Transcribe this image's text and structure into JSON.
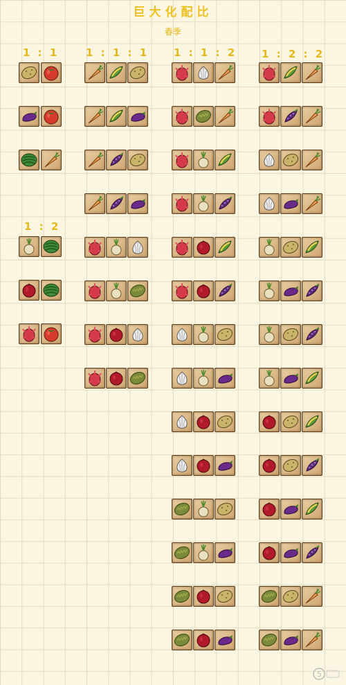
{
  "header": {
    "title": "巨大化配比",
    "season": "春季"
  },
  "ratios": {
    "r11": "1 : 1",
    "r12": "1 : 2",
    "r111": "1 : 1 : 1",
    "r112": "1 : 1 : 2",
    "r122": "1 : 2 : 2"
  },
  "colors": {
    "accent": "#e6b81a",
    "grid": "#e4dcc0",
    "background": "#fbf6e2",
    "tile": "#d8b584"
  },
  "icon_names": {
    "potato": "potato-icon",
    "tomato": "tomato-icon",
    "eggplant": "eggplant-icon",
    "watermelon": "watermelon-icon",
    "carrot": "carrot-icon",
    "corn": "corn-icon",
    "asparagus": "asparagus-icon",
    "dragonfruit": "dragonfruit-icon",
    "garlic": "garlic-icon",
    "durian": "durian-icon",
    "onion": "onion-icon",
    "pomegranate": "pomegranate-icon"
  },
  "groups": [
    {
      "ratio_key": "r11",
      "combos": [
        [
          "potato",
          "tomato"
        ],
        [
          "eggplant",
          "tomato"
        ],
        [
          "watermelon",
          "carrot"
        ]
      ]
    },
    {
      "ratio_key": "r12",
      "combos": [
        [
          "onion",
          "watermelon"
        ],
        [
          "pomegranate",
          "watermelon"
        ],
        [
          "dragonfruit",
          "tomato"
        ]
      ]
    },
    {
      "ratio_key": "r111",
      "combos": [
        [
          "carrot",
          "corn",
          "potato"
        ],
        [
          "carrot",
          "corn",
          "eggplant"
        ],
        [
          "carrot",
          "asparagus",
          "potato"
        ],
        [
          "carrot",
          "asparagus",
          "eggplant"
        ],
        [
          "dragonfruit",
          "onion",
          "garlic"
        ],
        [
          "dragonfruit",
          "onion",
          "durian"
        ],
        [
          "dragonfruit",
          "pomegranate",
          "garlic"
        ],
        [
          "dragonfruit",
          "pomegranate",
          "durian"
        ]
      ]
    },
    {
      "ratio_key": "r112",
      "combos": [
        [
          "dragonfruit",
          "garlic",
          "carrot"
        ],
        [
          "dragonfruit",
          "durian",
          "carrot"
        ],
        [
          "dragonfruit",
          "onion",
          "corn"
        ],
        [
          "dragonfruit",
          "onion",
          "asparagus"
        ],
        [
          "dragonfruit",
          "pomegranate",
          "corn"
        ],
        [
          "dragonfruit",
          "pomegranate",
          "asparagus"
        ],
        [
          "garlic",
          "onion",
          "potato"
        ],
        [
          "garlic",
          "onion",
          "eggplant"
        ],
        [
          "garlic",
          "pomegranate",
          "potato"
        ],
        [
          "garlic",
          "pomegranate",
          "eggplant"
        ],
        [
          "durian",
          "onion",
          "potato"
        ],
        [
          "durian",
          "onion",
          "eggplant"
        ],
        [
          "durian",
          "pomegranate",
          "potato"
        ],
        [
          "durian",
          "pomegranate",
          "eggplant"
        ]
      ]
    },
    {
      "ratio_key": "r122",
      "combos": [
        [
          "dragonfruit",
          "corn",
          "carrot"
        ],
        [
          "dragonfruit",
          "asparagus",
          "carrot"
        ],
        [
          "garlic",
          "potato",
          "carrot"
        ],
        [
          "garlic",
          "eggplant",
          "carrot"
        ],
        [
          "onion",
          "potato",
          "corn"
        ],
        [
          "onion",
          "eggplant",
          "asparagus"
        ],
        [
          "onion",
          "potato",
          "asparagus"
        ],
        [
          "onion",
          "eggplant",
          "corn"
        ],
        [
          "pomegranate",
          "potato",
          "corn"
        ],
        [
          "pomegranate",
          "potato",
          "asparagus"
        ],
        [
          "pomegranate",
          "eggplant",
          "corn"
        ],
        [
          "pomegranate",
          "eggplant",
          "asparagus"
        ],
        [
          "durian",
          "potato",
          "carrot"
        ],
        [
          "durian",
          "eggplant",
          "carrot"
        ]
      ]
    }
  ]
}
